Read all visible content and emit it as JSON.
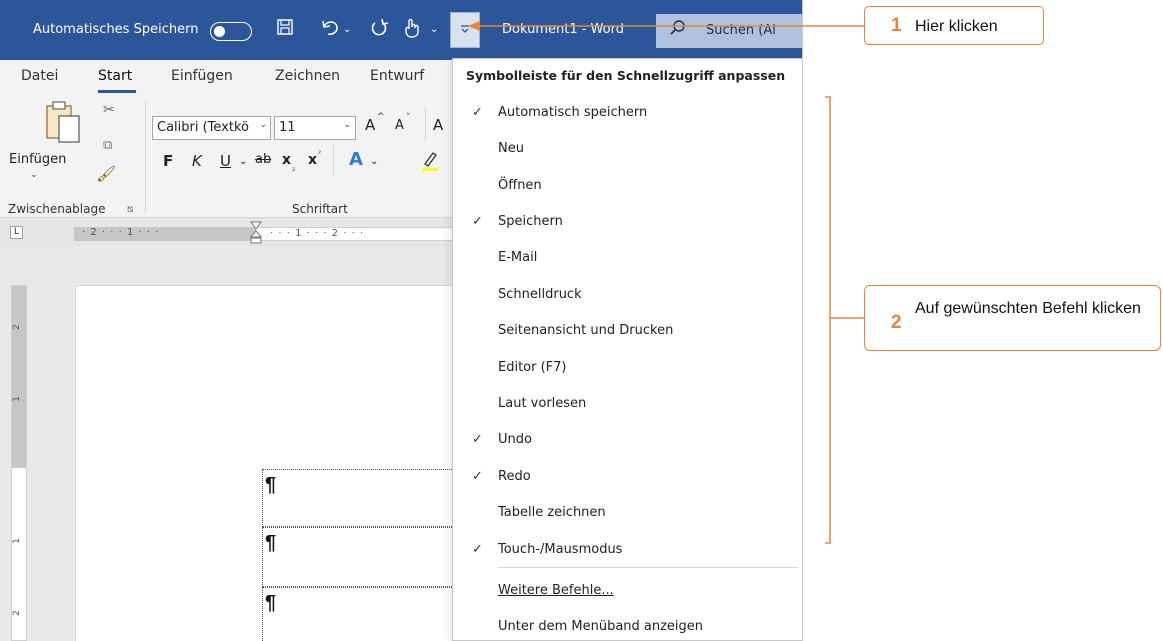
{
  "titlebar": {
    "autosave_label": "Automatisches Speichern",
    "autosave_on": false,
    "doc_title": "Dokument1 - Word",
    "search_text": "Suchen (Al",
    "save_icon": "save-icon",
    "undo_icon": "undo-icon",
    "redo_icon": "redo-icon",
    "touch_icon": "touch-mouse-icon",
    "qat_dropdown_icon": "qat-customize-icon",
    "bg_color": "#2b579a"
  },
  "tabs": [
    "Datei",
    "Start",
    "Einfügen",
    "Zeichnen",
    "Entwurf"
  ],
  "active_tab": "Start",
  "ribbon": {
    "paste_label": "Einfügen",
    "clipboard_group": "Zwischenablage",
    "font_group": "Schriftart",
    "font_name": "Calibri (Textkö",
    "font_size": "11",
    "bold": "F",
    "italic": "K",
    "underline": "U",
    "strike": "ab",
    "subscript": "x",
    "superscript": "x",
    "text_effect": "A",
    "grow": "A",
    "shrink": "A"
  },
  "ruler": {
    "tab_glyph": "L",
    "left_numbers": "· 2 · · · 1 · · ·",
    "right_numbers": "· · · 1 · · · 2 · · ·",
    "vertical_numbers": [
      "2",
      "1",
      "1",
      "2"
    ]
  },
  "document": {
    "pilcrow": "¶"
  },
  "menu": {
    "header": "Symbolleiste für den Schnellzugriff anpassen",
    "items": [
      {
        "label": "Automatisch speichern",
        "checked": "✓"
      },
      {
        "label": "Neu",
        "checked": ""
      },
      {
        "label": "Öffnen",
        "checked": ""
      },
      {
        "label": "Speichern",
        "checked": "✓"
      },
      {
        "label": "E-Mail",
        "checked": ""
      },
      {
        "label": "Schnelldruck",
        "checked": ""
      },
      {
        "label": "Seitenansicht und Drucken",
        "checked": ""
      },
      {
        "label": "Editor (F7)",
        "checked": ""
      },
      {
        "label": "Laut vorlesen",
        "checked": ""
      },
      {
        "label": "Undo",
        "checked": "✓"
      },
      {
        "label": "Redo",
        "checked": "✓"
      },
      {
        "label": "Tabelle zeichnen",
        "checked": ""
      },
      {
        "label": "Touch-/Mausmodus",
        "checked": "✓"
      }
    ],
    "more_commands": "Weitere Befehle...",
    "show_below": "Unter dem Menüband anzeigen"
  },
  "callouts": {
    "one_num": "1",
    "one_text": "Hier klicken",
    "two_num": "2",
    "two_text": "Auf gewünschten Befehl klicken",
    "accent": "#e8853a"
  }
}
